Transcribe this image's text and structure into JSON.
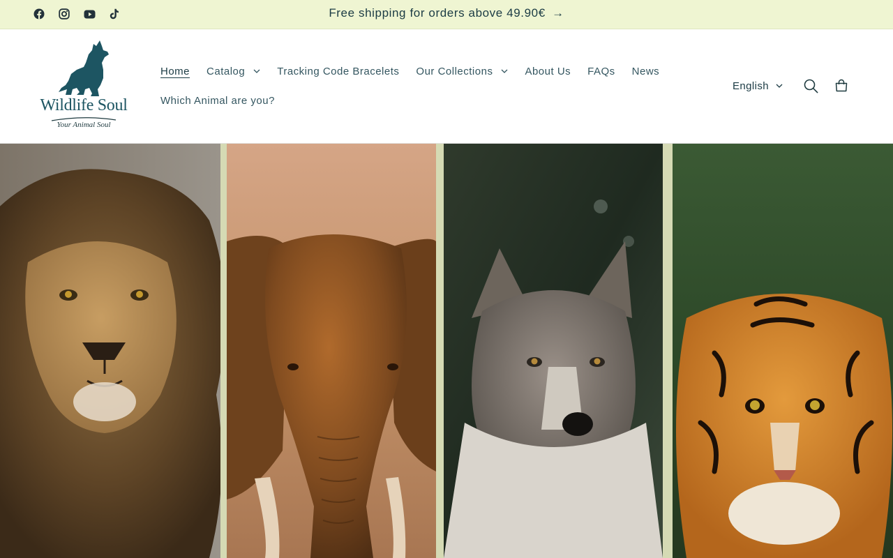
{
  "announcement": {
    "text": "Free shipping for orders above 49.90€",
    "arrow": "→"
  },
  "socials": [
    {
      "name": "facebook-icon"
    },
    {
      "name": "instagram-icon"
    },
    {
      "name": "youtube-icon"
    },
    {
      "name": "tiktok-icon"
    }
  ],
  "logo": {
    "name": "Wildlife Soul",
    "tagline": "Your Animal Soul"
  },
  "nav": {
    "home": "Home",
    "catalog": "Catalog",
    "tracking": "Tracking Code Bracelets",
    "collections": "Our Collections",
    "about": "About Us",
    "faqs": "FAQs",
    "news": "News",
    "which_animal": "Which Animal are you?"
  },
  "header": {
    "language": "English"
  },
  "hero": {
    "panels": [
      "lion",
      "elephant",
      "wolf",
      "tiger"
    ]
  },
  "colors": {
    "announcement_bg": "#eff5d2",
    "brand": "#1d5562",
    "text": "#1b3b44"
  }
}
